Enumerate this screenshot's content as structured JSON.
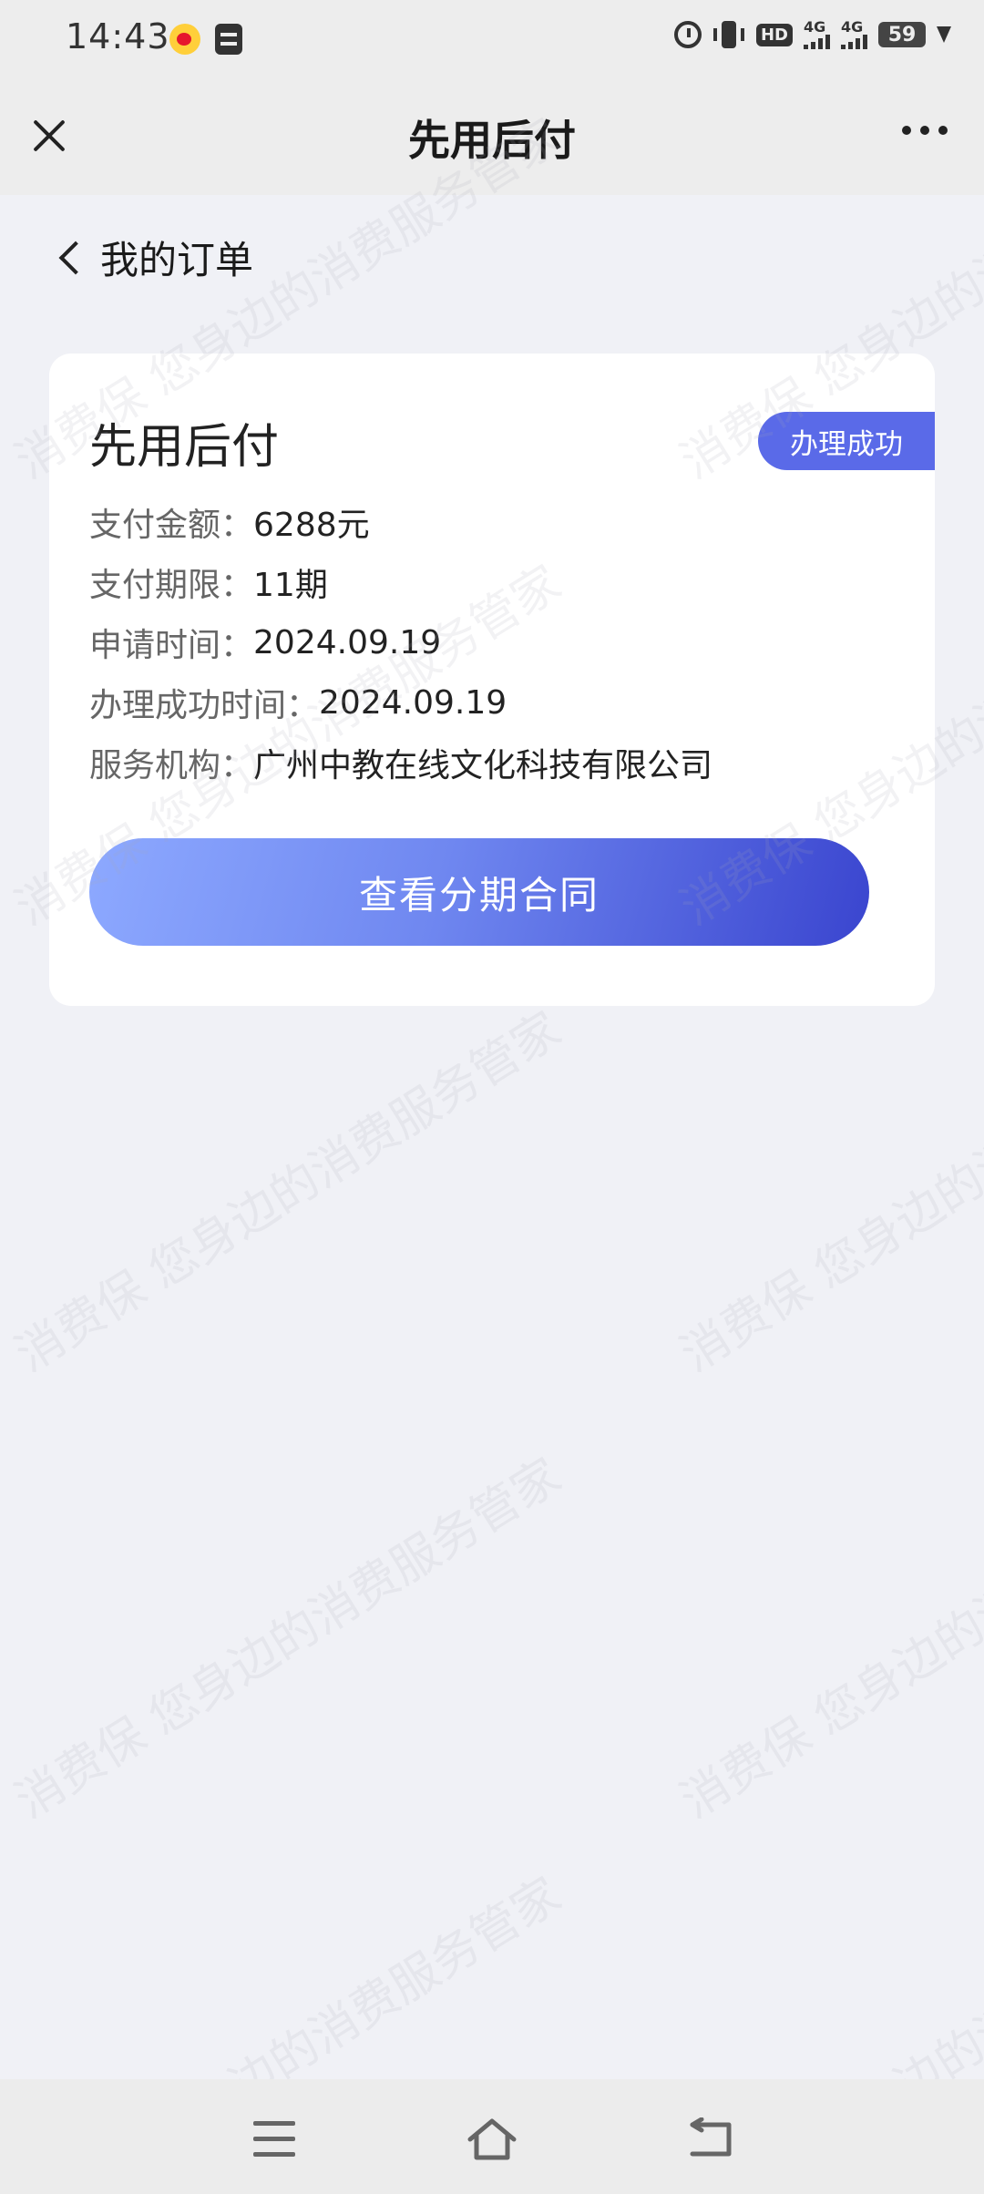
{
  "status_bar": {
    "time": "14:43",
    "network_1": "4G",
    "network_2": "4G",
    "hd_label": "HD",
    "battery": "59"
  },
  "header": {
    "title": "先用后付"
  },
  "back": {
    "label": "我的订单"
  },
  "card": {
    "title": "先用后付",
    "status_badge": "办理成功",
    "rows": [
      {
        "label": "支付金额：",
        "value": "6288元"
      },
      {
        "label": "支付期限：",
        "value": "11期"
      },
      {
        "label": "申请时间：",
        "value": "2024.09.19"
      },
      {
        "label": "办理成功时间：",
        "value": "2024.09.19"
      },
      {
        "label": "服务机构：",
        "value": "广州中教在线文化科技有限公司"
      }
    ],
    "contract_button": "查看分期合同"
  },
  "watermark": {
    "text": "消费保 您身边的消费服务管家"
  },
  "colors": {
    "badge": "#5a6ae8",
    "button_start": "#8da9ff",
    "button_end": "#3a45cf",
    "page_bg": "#f0f1f6"
  }
}
